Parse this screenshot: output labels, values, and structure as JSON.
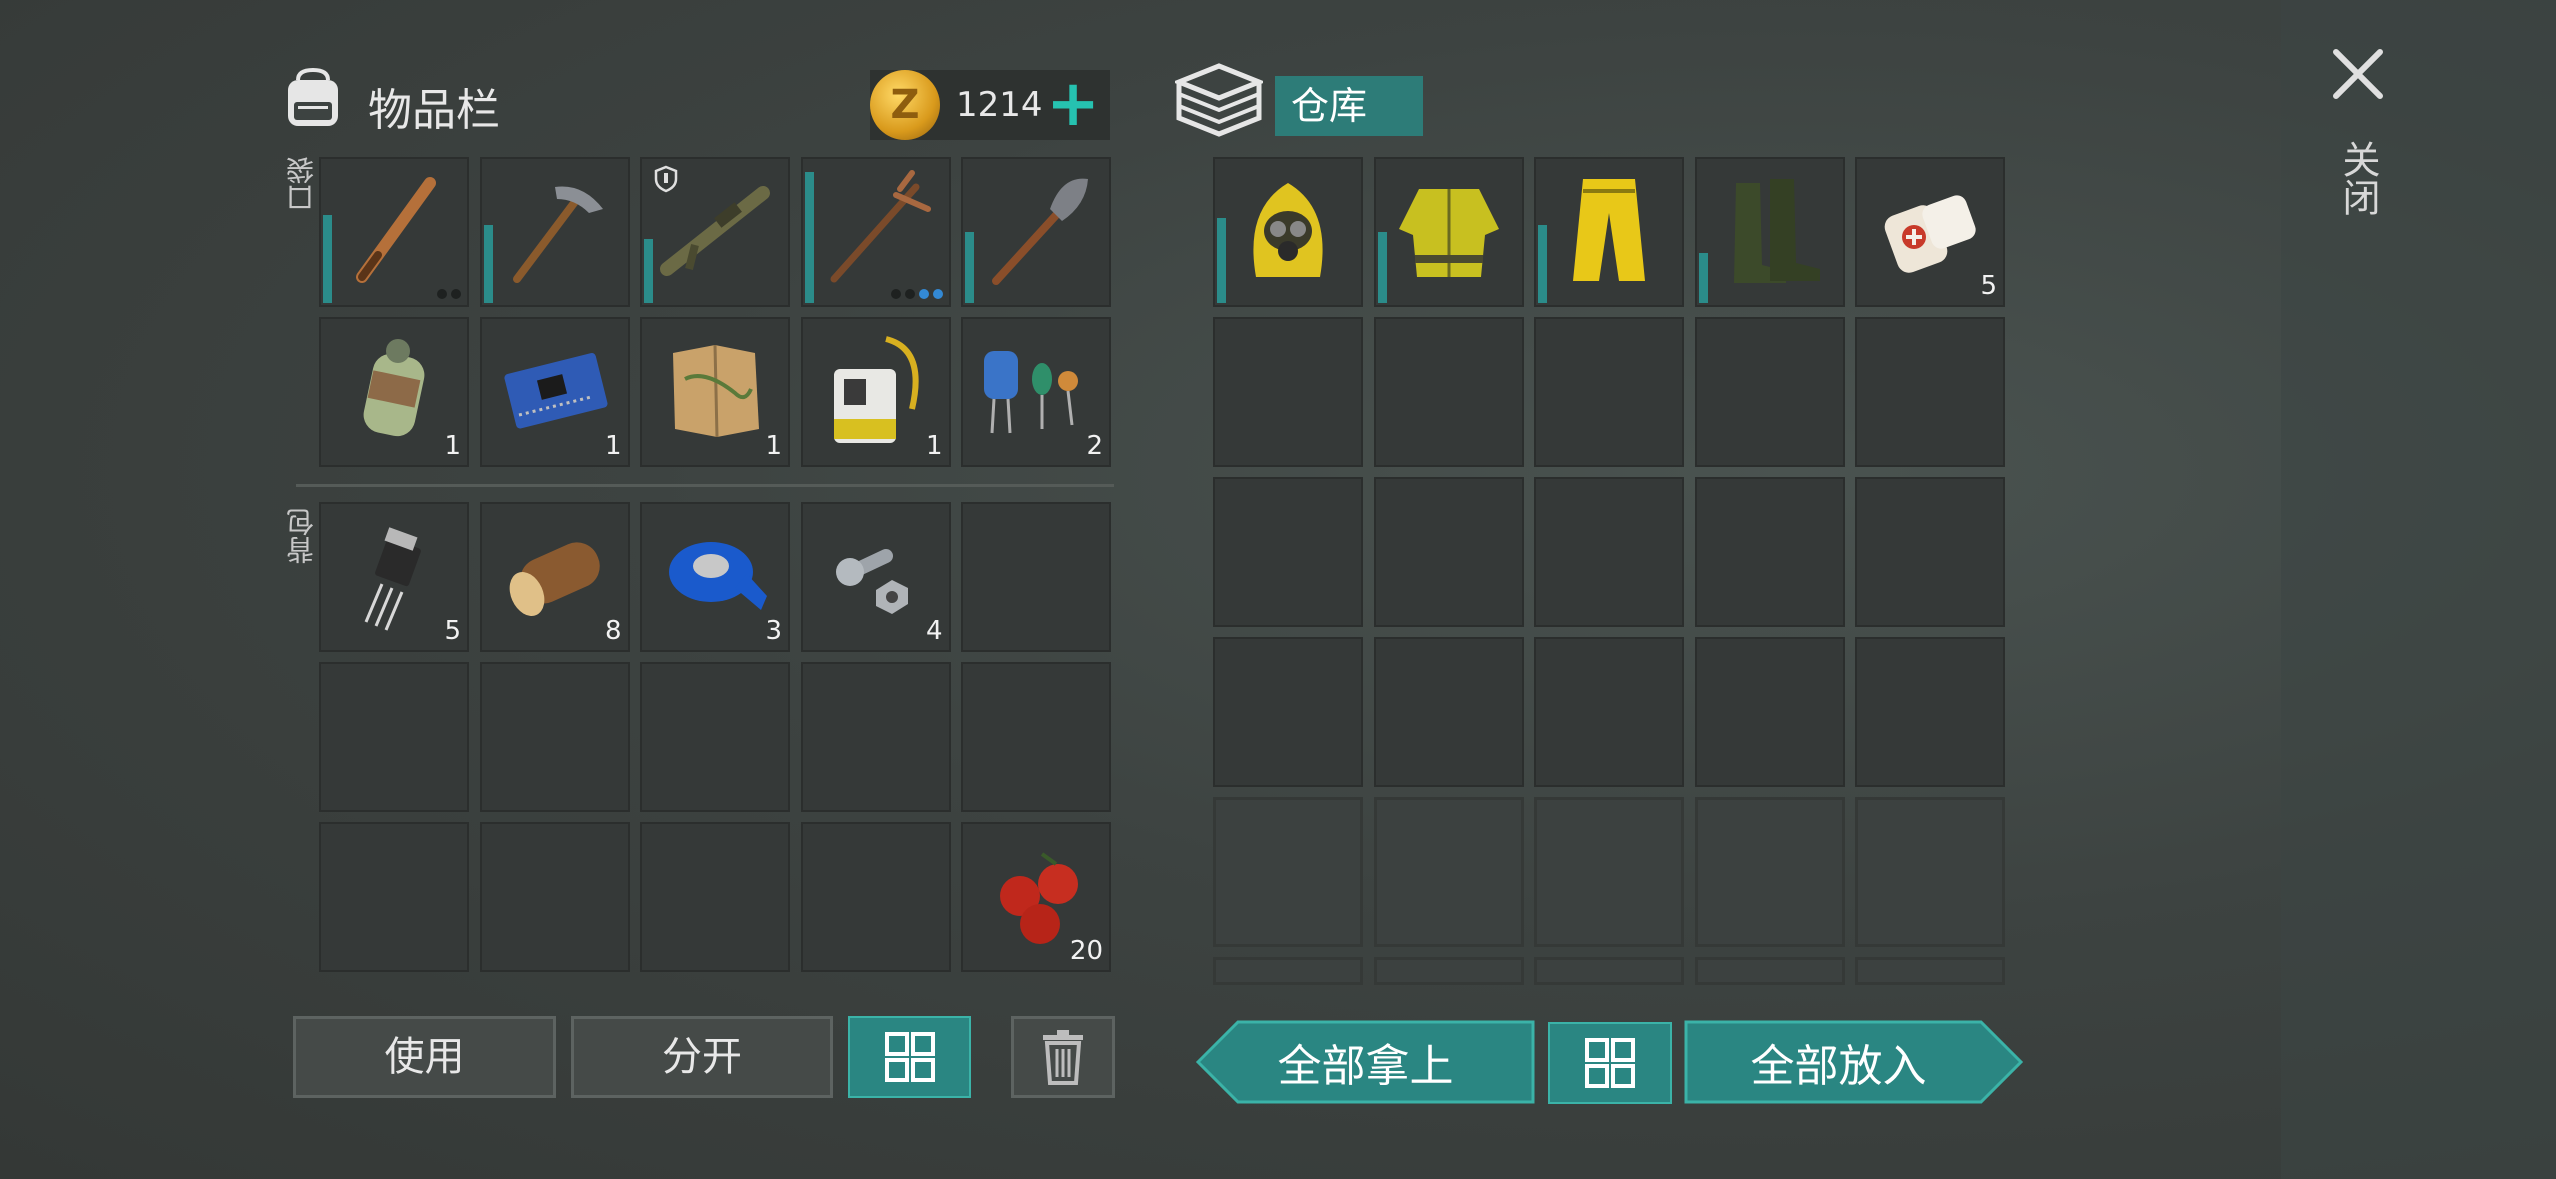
{
  "inventory": {
    "title": "物品栏",
    "coins": "1214",
    "pockets_label": "口袋",
    "backpack_label": "背包",
    "pocket_slots": [
      {
        "item": "baseball-bat",
        "count": "",
        "durability": 0.62,
        "dots": [
          "dark",
          "dark"
        ]
      },
      {
        "item": "pickaxe",
        "count": "",
        "durability": 0.55
      },
      {
        "item": "rifle",
        "count": "",
        "durability": 0.45,
        "shield": true
      },
      {
        "item": "crowbar-pick",
        "count": "",
        "durability": 0.92,
        "dots": [
          "dark",
          "dark",
          "blue",
          "blue"
        ]
      },
      {
        "item": "shovel",
        "count": "",
        "durability": 0.5
      },
      {
        "item": "gas-canister",
        "count": "1"
      },
      {
        "item": "circuit-board",
        "count": "1"
      },
      {
        "item": "map",
        "count": "1"
      },
      {
        "item": "id-badge",
        "count": "1"
      },
      {
        "item": "electronic-components",
        "count": "2"
      }
    ],
    "backpack_slots": [
      {
        "item": "transistor",
        "count": "5"
      },
      {
        "item": "wood-log",
        "count": "8"
      },
      {
        "item": "duct-tape",
        "count": "3"
      },
      {
        "item": "bolt-nut",
        "count": "4"
      },
      {
        "item": "",
        "count": ""
      },
      {
        "item": "",
        "count": ""
      },
      {
        "item": "",
        "count": ""
      },
      {
        "item": "",
        "count": ""
      },
      {
        "item": "",
        "count": ""
      },
      {
        "item": "",
        "count": ""
      },
      {
        "item": "",
        "count": ""
      },
      {
        "item": "",
        "count": ""
      },
      {
        "item": "",
        "count": ""
      },
      {
        "item": "",
        "count": ""
      },
      {
        "item": "berries",
        "count": "20"
      }
    ],
    "buttons": {
      "use": "使用",
      "split": "分开"
    }
  },
  "storage": {
    "title": "仓库",
    "slots": [
      {
        "item": "hazmat-hood",
        "count": "",
        "durability": 0.6
      },
      {
        "item": "hazmat-jacket",
        "count": "",
        "durability": 0.5
      },
      {
        "item": "hazmat-pants",
        "count": "",
        "durability": 0.55
      },
      {
        "item": "rubber-boots",
        "count": "",
        "durability": 0.35
      },
      {
        "item": "bandage",
        "count": "5"
      }
    ],
    "buttons": {
      "take_all": "全部拿上",
      "put_all": "全部放入"
    }
  },
  "close_label": "关闭",
  "colors": {
    "accent": "#2a8682",
    "accent_bright": "#26c2b0",
    "slot_bg": "#353938"
  }
}
